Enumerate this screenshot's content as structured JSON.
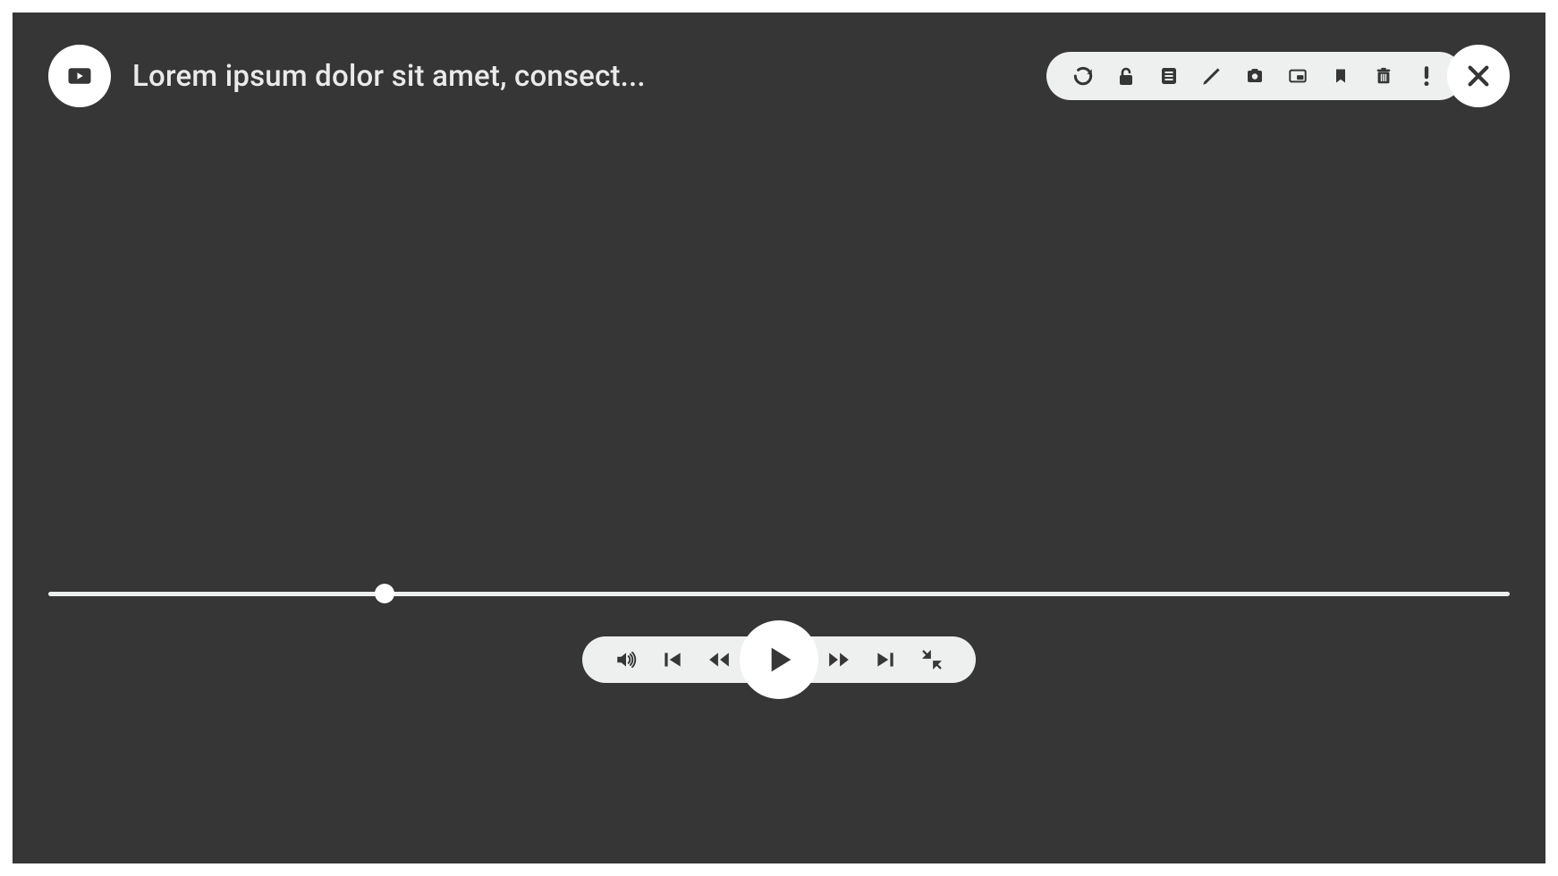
{
  "header": {
    "title": "Lorem ipsum dolor sit amet, consect..."
  },
  "toolbar": {
    "icons": [
      "refresh",
      "unlock",
      "notes",
      "edit",
      "camera",
      "pip",
      "bookmark",
      "trash",
      "report"
    ]
  },
  "progress": {
    "percent": 23
  },
  "controls": {
    "left": [
      "volume",
      "previous",
      "rewind"
    ],
    "center": "play",
    "right": [
      "forward",
      "next",
      "collapse"
    ]
  }
}
